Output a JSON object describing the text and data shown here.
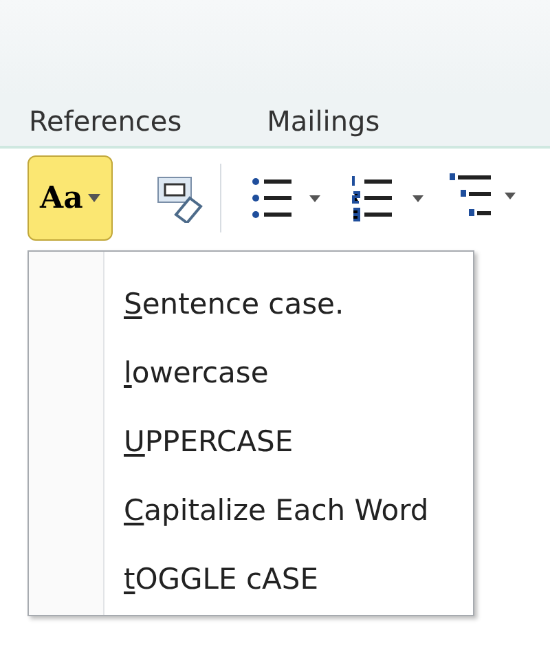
{
  "tabs": [
    {
      "label": "References"
    },
    {
      "label": "Mailings"
    }
  ],
  "toolbar": {
    "change_case_button": {
      "label": "Aa",
      "pressed": true
    }
  },
  "menu": {
    "items": [
      {
        "access_key": "S",
        "rest": "entence case."
      },
      {
        "access_key": "l",
        "rest": "owercase"
      },
      {
        "access_key": "U",
        "rest": "PPERCASE"
      },
      {
        "access_key": "C",
        "rest": "apitalize Each Word"
      },
      {
        "access_key": "t",
        "rest": "OGGLE cASE"
      }
    ]
  }
}
